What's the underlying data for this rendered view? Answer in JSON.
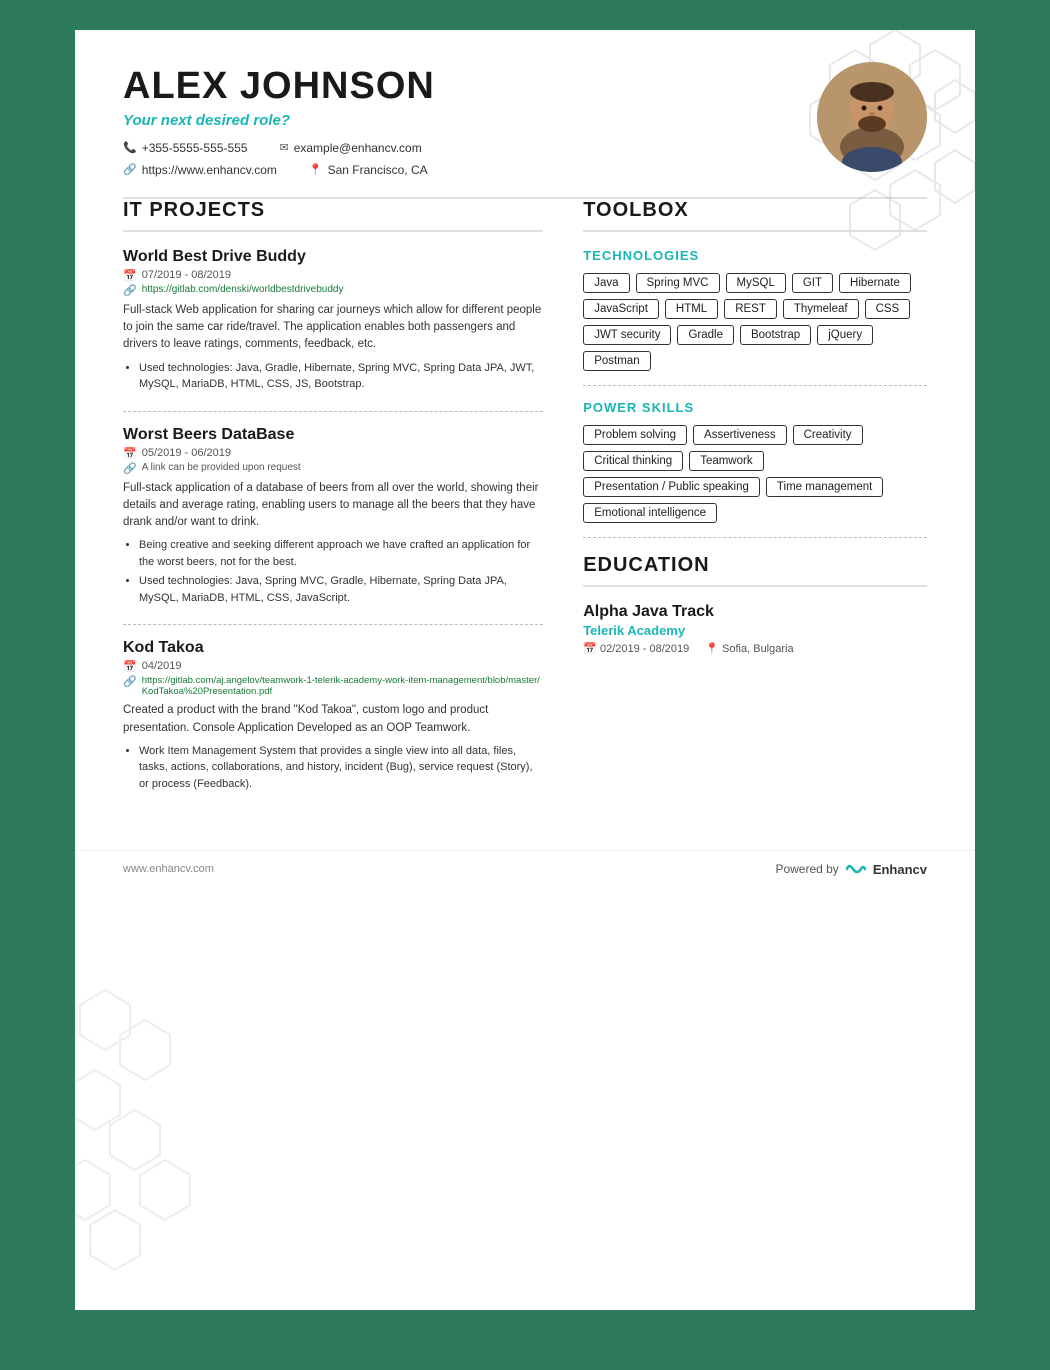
{
  "header": {
    "name": "ALEX JOHNSON",
    "role": "Your next desired role?",
    "phone": "+355-5555-555-555",
    "website": "https://www.enhancv.com",
    "email": "example@enhancv.com",
    "location": "San Francisco, CA"
  },
  "sections": {
    "it_projects": {
      "title": "IT PROJECTS",
      "projects": [
        {
          "name": "World Best Drive Buddy",
          "date": "07/2019 - 08/2019",
          "link": "https://gitlab.com/denski/worldbestdrivebuddy",
          "description": "Full-stack Web application for sharing car journeys which allow for different people to join the same car ride/travel. The application enables both passengers and drivers to leave ratings, comments, feedback, etc.",
          "bullets": [
            "Used technologies: Java, Gradle, Hibernate, Spring MVC, Spring Data JPA, JWT, MySQL, MariaDB, HTML, CSS, JS, Bootstrap."
          ]
        },
        {
          "name": "Worst Beers DataBase",
          "date": "05/2019 - 06/2019",
          "link": "A link can be provided upon request",
          "description": "Full-stack application of a database of beers from all over the world, showing their details and average rating, enabling users to manage all the beers that they have drank and/or want to drink.",
          "bullets": [
            "Being creative and seeking different approach we have crafted an application for the worst beers, not for the best.",
            "Used technologies: Java, Spring MVC, Gradle, Hibernate, Spring Data JPA, MySQL, MariaDB, HTML, CSS, JavaScript."
          ]
        },
        {
          "name": "Kod Takoa",
          "date": "04/2019",
          "link": "https://gitlab.com/aj.angelov/teamwork-1-telerik-academy-work-item-management/blob/master/KodTakoa%20Presentation.pdf",
          "description": "Created a product with the brand \"Kod Takoa\", custom logo and product presentation. Console Application Developed as an OOP Teamwork.",
          "bullets": [
            "Work Item Management System that provides a single view into all data, files, tasks, actions, collaborations, and history, incident (Bug), service request (Story), or process (Feedback)."
          ]
        }
      ]
    },
    "toolbox": {
      "title": "TOOLBOX",
      "technologies": {
        "subtitle": "TECHNOLOGIES",
        "tags": [
          "Java",
          "Spring MVC",
          "MySQL",
          "GIT",
          "Hibernate",
          "JavaScript",
          "HTML",
          "REST",
          "Thymeleaf",
          "CSS",
          "JWT security",
          "Gradle",
          "Bootstrap",
          "jQuery",
          "Postman"
        ]
      },
      "power_skills": {
        "subtitle": "POWER SKILLS",
        "tags": [
          "Problem solving",
          "Assertiveness",
          "Creativity",
          "Critical thinking",
          "Teamwork",
          "Presentation / Public speaking",
          "Time management",
          "Emotional intelligence"
        ]
      }
    },
    "education": {
      "title": "EDUCATION",
      "entries": [
        {
          "degree": "Alpha Java Track",
          "school": "Telerik Academy",
          "date": "02/2019 - 08/2019",
          "location": "Sofia, Bulgaria"
        }
      ]
    }
  },
  "footer": {
    "website": "www.enhancv.com",
    "powered_by": "Powered by",
    "brand": "Enhancv"
  }
}
